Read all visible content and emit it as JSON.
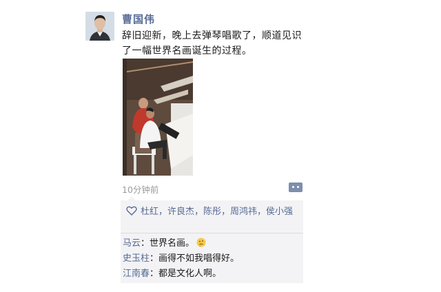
{
  "post": {
    "author": "曹国伟",
    "text": "辞旧迎新，晚上去弹琴唱歌了，顺道见识了一幅世界名画诞生的过程。",
    "time": "10分钟前"
  },
  "likes": {
    "names": "杜红，许良杰，陈彤，周鸿祎，侯小强"
  },
  "comments": [
    {
      "name": "马云",
      "sep": "：",
      "text": "世界名画。",
      "emoji": "thinking-emoji"
    },
    {
      "name": "史玉柱",
      "sep": "：",
      "text": "画得不如我唱得好。"
    },
    {
      "name": "江南春",
      "sep": "：",
      "text": "都是文化人啊。"
    }
  ],
  "colors": {
    "name_link": "#576b95",
    "panel_bg": "#f3f3f5",
    "time_gray": "#9a9a9a"
  },
  "icons": {
    "like": "heart-outline-icon",
    "comment": "comment-bubble-icon"
  }
}
